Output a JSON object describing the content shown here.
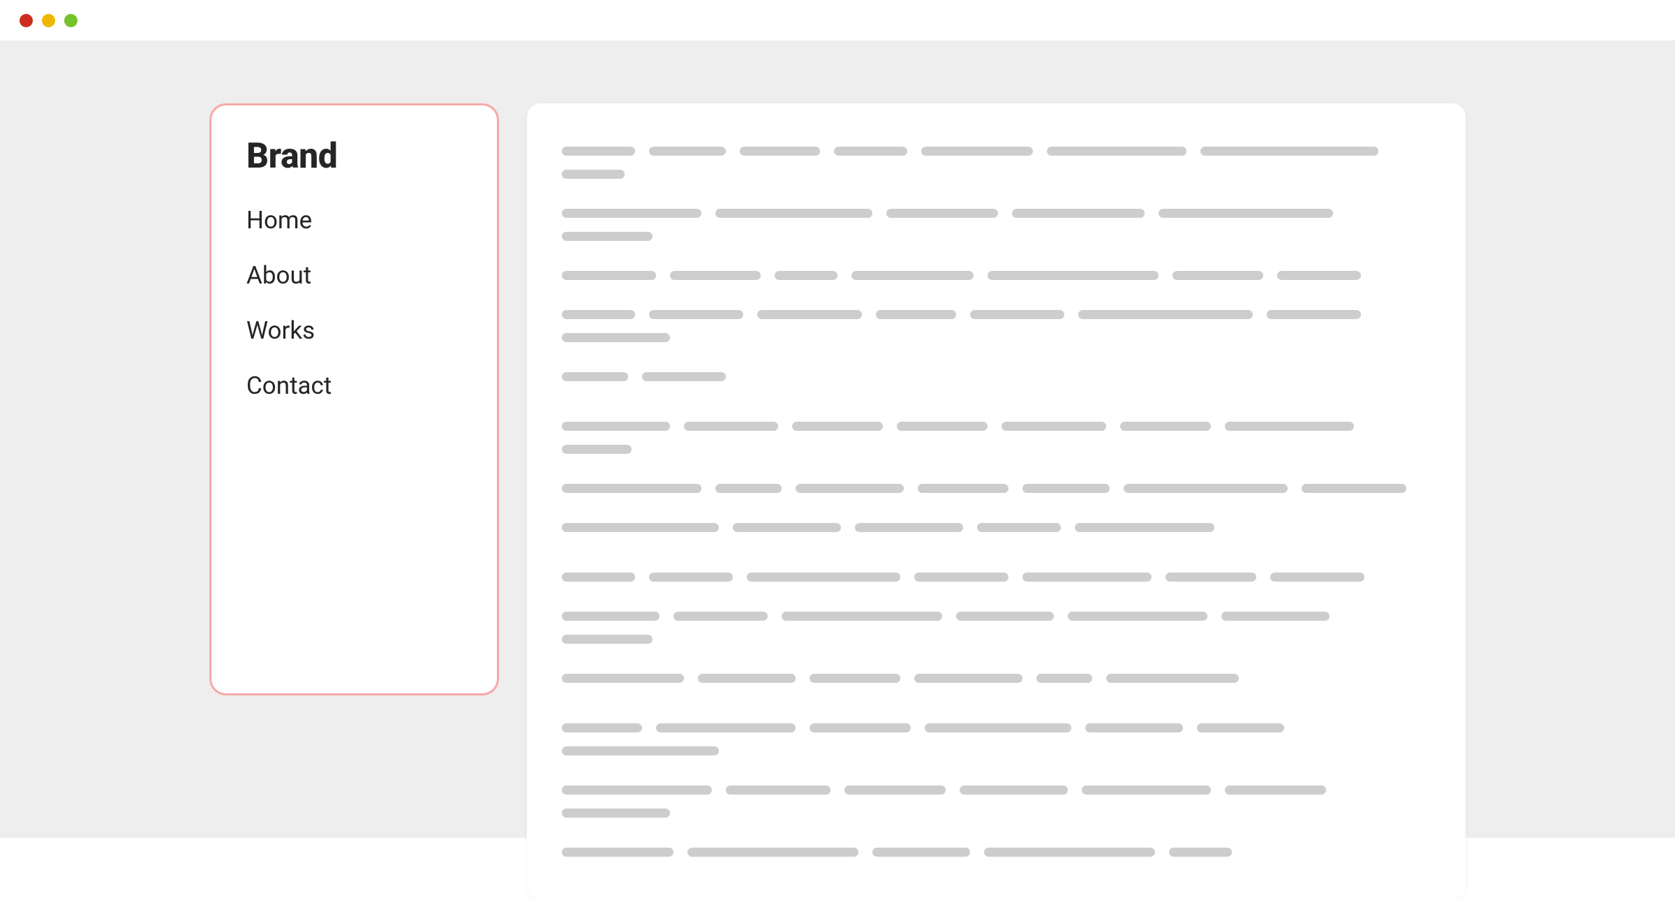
{
  "window": {
    "traffic_lights": [
      "close",
      "minimize",
      "maximize"
    ]
  },
  "sidebar": {
    "brand": "Brand",
    "border_color": "#f8a8a8",
    "nav_items": [
      {
        "id": "home",
        "label": "Home"
      },
      {
        "id": "about",
        "label": "About"
      },
      {
        "id": "works",
        "label": "Works"
      },
      {
        "id": "contact",
        "label": "Contact"
      }
    ]
  },
  "content": {
    "placeholder_color": "#cdcdcd",
    "paragraphs": [
      {
        "lines": [
          [
            105,
            110,
            115,
            105,
            160,
            200,
            255,
            90
          ],
          [
            200,
            225,
            160,
            190,
            250,
            130
          ],
          [
            135,
            130,
            90,
            175,
            245,
            130,
            120
          ],
          [
            105,
            135,
            150,
            115,
            135,
            250,
            135,
            155
          ],
          [
            95,
            120
          ]
        ]
      },
      {
        "lines": [
          [
            155,
            135,
            130,
            130,
            150,
            130,
            185,
            100
          ],
          [
            200,
            95,
            155,
            130,
            125,
            235,
            150
          ],
          [
            225,
            155,
            155,
            120,
            200
          ]
        ]
      },
      {
        "lines": [
          [
            105,
            120,
            220,
            135,
            185,
            130,
            135
          ],
          [
            140,
            135,
            230,
            140,
            200,
            155,
            130
          ],
          [
            175,
            140,
            130,
            155,
            80,
            190
          ]
        ]
      },
      {
        "lines": [
          [
            115,
            200,
            145,
            210,
            140,
            125,
            225
          ],
          [
            215,
            150,
            145,
            155,
            185,
            145,
            155
          ],
          [
            160,
            245,
            140,
            245,
            90
          ]
        ]
      }
    ]
  }
}
